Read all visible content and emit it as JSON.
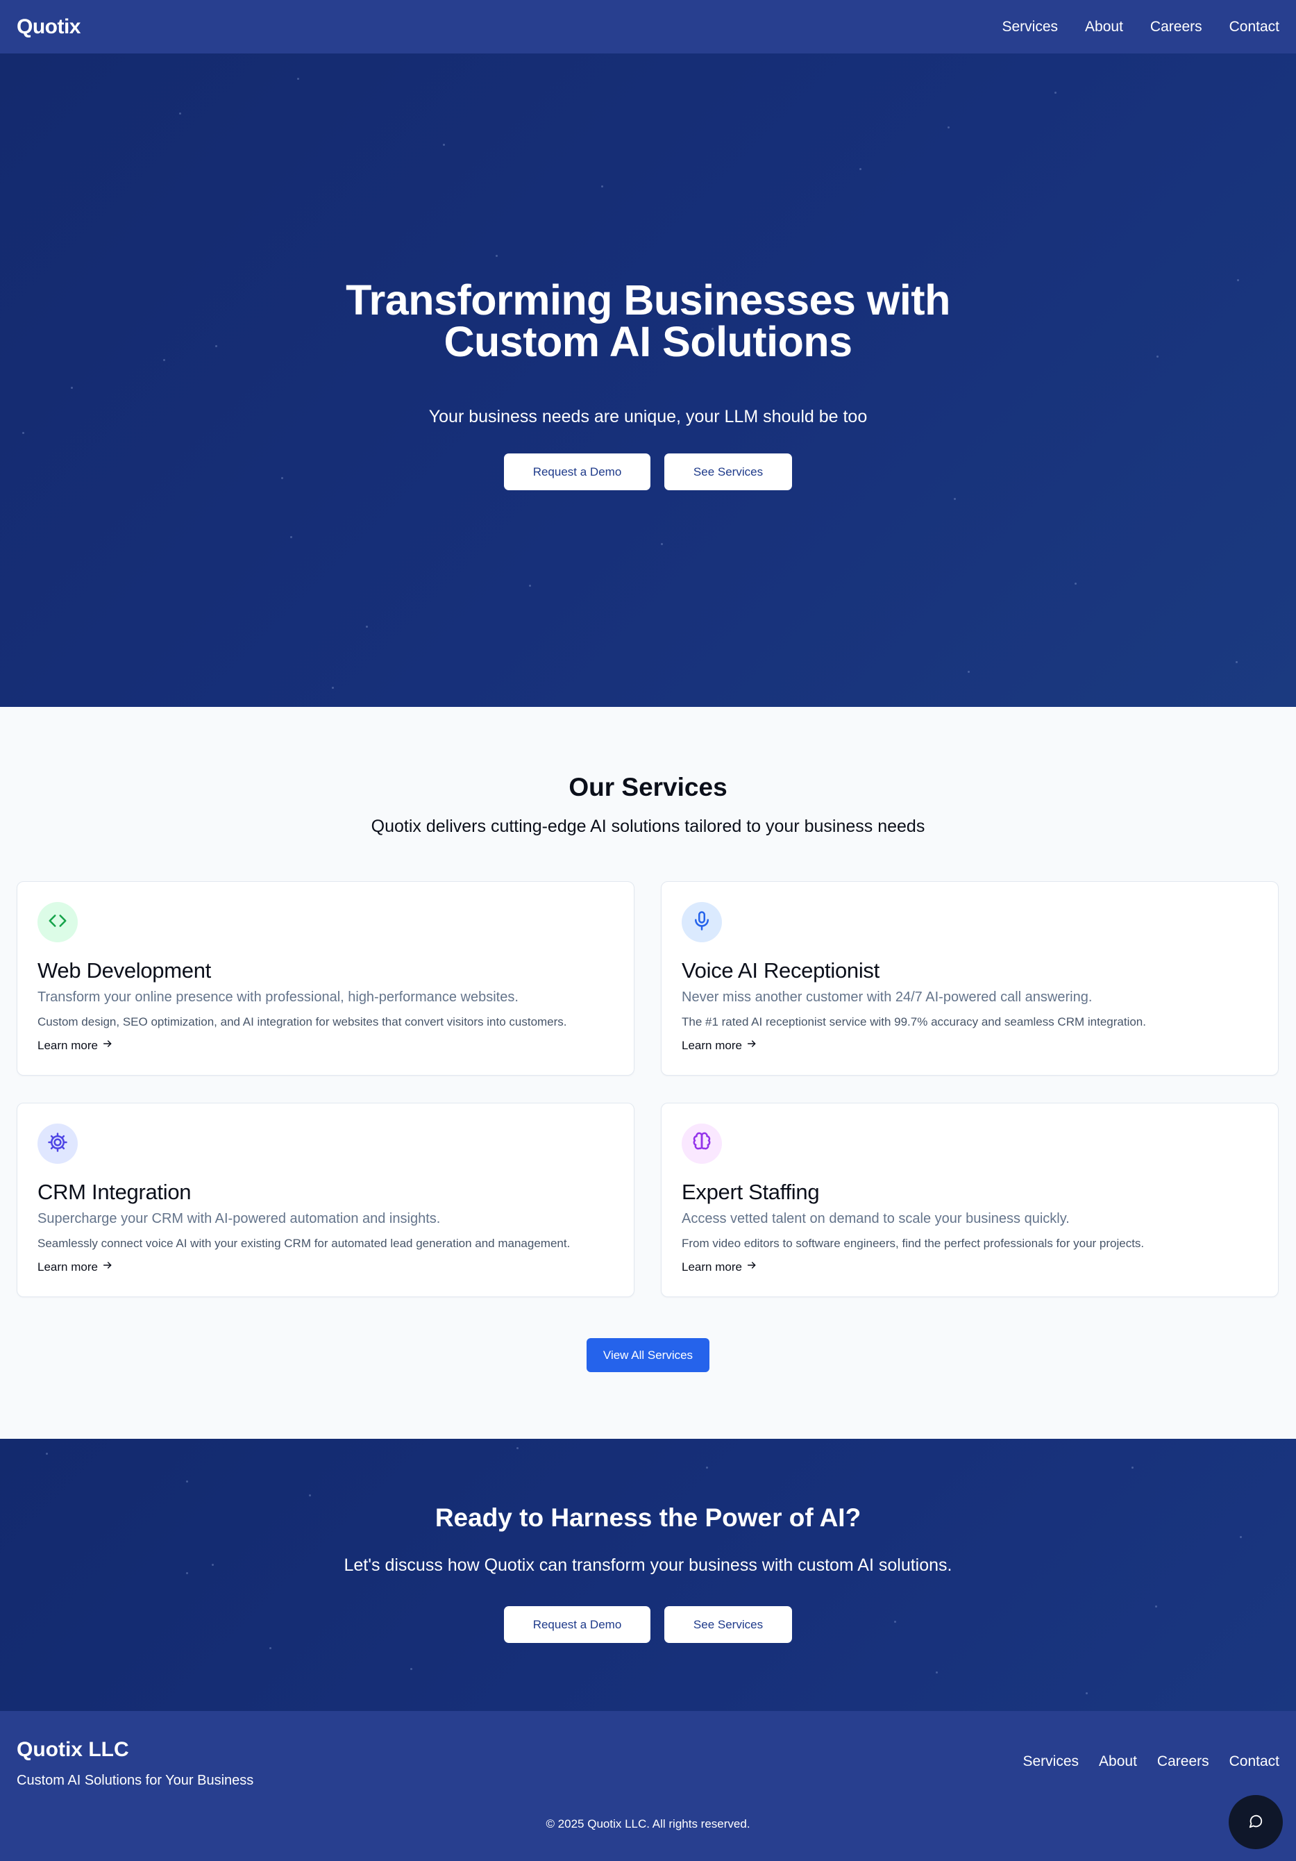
{
  "nav": {
    "brand": "Quotix",
    "links": [
      "Services",
      "About",
      "Careers",
      "Contact"
    ]
  },
  "hero": {
    "title_line1": "Transforming Businesses with",
    "title_line2": "Custom AI Solutions",
    "subtitle": "Your business needs are unique, your LLM should be too",
    "primary_button": "Request a Demo",
    "secondary_button": "See Services"
  },
  "services": {
    "heading": "Our Services",
    "lead": "Quotix delivers cutting-edge AI solutions tailored to your business needs",
    "cards": [
      {
        "title": "Web Development",
        "tagline": "Transform your online presence with professional, high-performance websites.",
        "description": "Custom design, SEO optimization, and AI integration for websites that convert visitors into customers.",
        "link": "Learn more",
        "icon": "code-icon",
        "icon_bg": "#dcfce7",
        "icon_color": "#16a34a"
      },
      {
        "title": "Voice AI Receptionist",
        "tagline": "Never miss another customer with 24/7 AI-powered call answering.",
        "description": "The #1 rated AI receptionist service with 99.7% accuracy and seamless CRM integration.",
        "link": "Learn more",
        "icon": "microphone-icon",
        "icon_bg": "#dbeafe",
        "icon_color": "#2563eb"
      },
      {
        "title": "CRM Integration",
        "tagline": "Supercharge your CRM with AI-powered automation and insights.",
        "description": "Seamlessly connect voice AI with your existing CRM for automated lead generation and management.",
        "link": "Learn more",
        "icon": "gear-icon",
        "icon_bg": "#e0e7ff",
        "icon_color": "#4f46e5"
      },
      {
        "title": "Expert Staffing",
        "tagline": "Access vetted talent on demand to scale your business quickly.",
        "description": "From video editors to software engineers, find the perfect professionals for your projects.",
        "link": "Learn more",
        "icon": "brain-icon",
        "icon_bg": "#fae8ff",
        "icon_color": "#9333ea"
      }
    ],
    "view_all_button": "View All Services"
  },
  "cta": {
    "heading": "Ready to Harness the Power of AI?",
    "subtitle": "Let's discuss how Quotix can transform your business with custom AI solutions.",
    "primary_button": "Request a Demo",
    "secondary_button": "See Services"
  },
  "footer": {
    "brand": "Quotix LLC",
    "tagline": "Custom AI Solutions for Your Business",
    "links": [
      "Services",
      "About",
      "Careers",
      "Contact"
    ],
    "copyright": "© 2025 Quotix LLC. All rights reserved."
  },
  "chat": {
    "icon": "chat-bubble-icon"
  },
  "colors": {
    "nav_bg": "#283f8f",
    "hero_bg": "#17307a",
    "primary_blue": "#2563eb",
    "button_text": "#1e3a8a",
    "page_bg": "#f8fafc"
  }
}
